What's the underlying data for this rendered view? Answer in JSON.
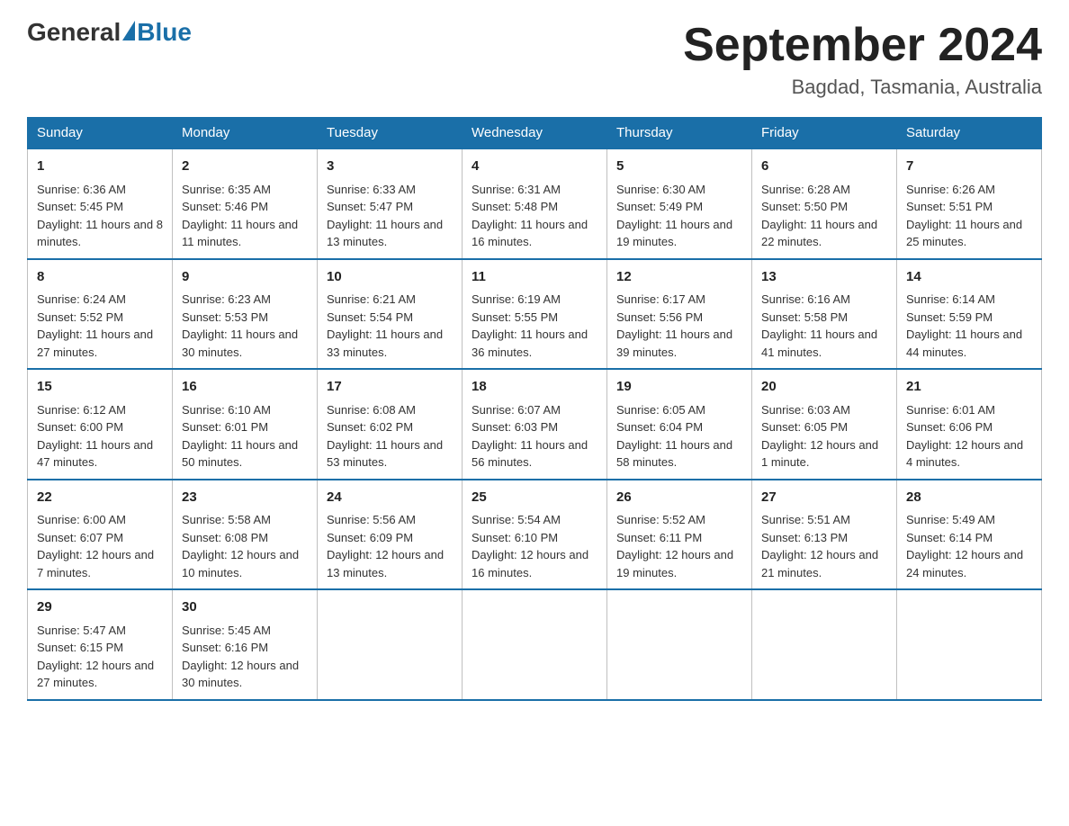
{
  "header": {
    "logo_general": "General",
    "logo_blue": "Blue",
    "month_title": "September 2024",
    "location": "Bagdad, Tasmania, Australia"
  },
  "days_of_week": [
    "Sunday",
    "Monday",
    "Tuesday",
    "Wednesday",
    "Thursday",
    "Friday",
    "Saturday"
  ],
  "weeks": [
    [
      {
        "day": "1",
        "sunrise": "6:36 AM",
        "sunset": "5:45 PM",
        "daylight": "11 hours and 8 minutes."
      },
      {
        "day": "2",
        "sunrise": "6:35 AM",
        "sunset": "5:46 PM",
        "daylight": "11 hours and 11 minutes."
      },
      {
        "day": "3",
        "sunrise": "6:33 AM",
        "sunset": "5:47 PM",
        "daylight": "11 hours and 13 minutes."
      },
      {
        "day": "4",
        "sunrise": "6:31 AM",
        "sunset": "5:48 PM",
        "daylight": "11 hours and 16 minutes."
      },
      {
        "day": "5",
        "sunrise": "6:30 AM",
        "sunset": "5:49 PM",
        "daylight": "11 hours and 19 minutes."
      },
      {
        "day": "6",
        "sunrise": "6:28 AM",
        "sunset": "5:50 PM",
        "daylight": "11 hours and 22 minutes."
      },
      {
        "day": "7",
        "sunrise": "6:26 AM",
        "sunset": "5:51 PM",
        "daylight": "11 hours and 25 minutes."
      }
    ],
    [
      {
        "day": "8",
        "sunrise": "6:24 AM",
        "sunset": "5:52 PM",
        "daylight": "11 hours and 27 minutes."
      },
      {
        "day": "9",
        "sunrise": "6:23 AM",
        "sunset": "5:53 PM",
        "daylight": "11 hours and 30 minutes."
      },
      {
        "day": "10",
        "sunrise": "6:21 AM",
        "sunset": "5:54 PM",
        "daylight": "11 hours and 33 minutes."
      },
      {
        "day": "11",
        "sunrise": "6:19 AM",
        "sunset": "5:55 PM",
        "daylight": "11 hours and 36 minutes."
      },
      {
        "day": "12",
        "sunrise": "6:17 AM",
        "sunset": "5:56 PM",
        "daylight": "11 hours and 39 minutes."
      },
      {
        "day": "13",
        "sunrise": "6:16 AM",
        "sunset": "5:58 PM",
        "daylight": "11 hours and 41 minutes."
      },
      {
        "day": "14",
        "sunrise": "6:14 AM",
        "sunset": "5:59 PM",
        "daylight": "11 hours and 44 minutes."
      }
    ],
    [
      {
        "day": "15",
        "sunrise": "6:12 AM",
        "sunset": "6:00 PM",
        "daylight": "11 hours and 47 minutes."
      },
      {
        "day": "16",
        "sunrise": "6:10 AM",
        "sunset": "6:01 PM",
        "daylight": "11 hours and 50 minutes."
      },
      {
        "day": "17",
        "sunrise": "6:08 AM",
        "sunset": "6:02 PM",
        "daylight": "11 hours and 53 minutes."
      },
      {
        "day": "18",
        "sunrise": "6:07 AM",
        "sunset": "6:03 PM",
        "daylight": "11 hours and 56 minutes."
      },
      {
        "day": "19",
        "sunrise": "6:05 AM",
        "sunset": "6:04 PM",
        "daylight": "11 hours and 58 minutes."
      },
      {
        "day": "20",
        "sunrise": "6:03 AM",
        "sunset": "6:05 PM",
        "daylight": "12 hours and 1 minute."
      },
      {
        "day": "21",
        "sunrise": "6:01 AM",
        "sunset": "6:06 PM",
        "daylight": "12 hours and 4 minutes."
      }
    ],
    [
      {
        "day": "22",
        "sunrise": "6:00 AM",
        "sunset": "6:07 PM",
        "daylight": "12 hours and 7 minutes."
      },
      {
        "day": "23",
        "sunrise": "5:58 AM",
        "sunset": "6:08 PM",
        "daylight": "12 hours and 10 minutes."
      },
      {
        "day": "24",
        "sunrise": "5:56 AM",
        "sunset": "6:09 PM",
        "daylight": "12 hours and 13 minutes."
      },
      {
        "day": "25",
        "sunrise": "5:54 AM",
        "sunset": "6:10 PM",
        "daylight": "12 hours and 16 minutes."
      },
      {
        "day": "26",
        "sunrise": "5:52 AM",
        "sunset": "6:11 PM",
        "daylight": "12 hours and 19 minutes."
      },
      {
        "day": "27",
        "sunrise": "5:51 AM",
        "sunset": "6:13 PM",
        "daylight": "12 hours and 21 minutes."
      },
      {
        "day": "28",
        "sunrise": "5:49 AM",
        "sunset": "6:14 PM",
        "daylight": "12 hours and 24 minutes."
      }
    ],
    [
      {
        "day": "29",
        "sunrise": "5:47 AM",
        "sunset": "6:15 PM",
        "daylight": "12 hours and 27 minutes."
      },
      {
        "day": "30",
        "sunrise": "5:45 AM",
        "sunset": "6:16 PM",
        "daylight": "12 hours and 30 minutes."
      },
      null,
      null,
      null,
      null,
      null
    ]
  ],
  "labels": {
    "sunrise_prefix": "Sunrise: ",
    "sunset_prefix": "Sunset: ",
    "daylight_prefix": "Daylight: "
  }
}
